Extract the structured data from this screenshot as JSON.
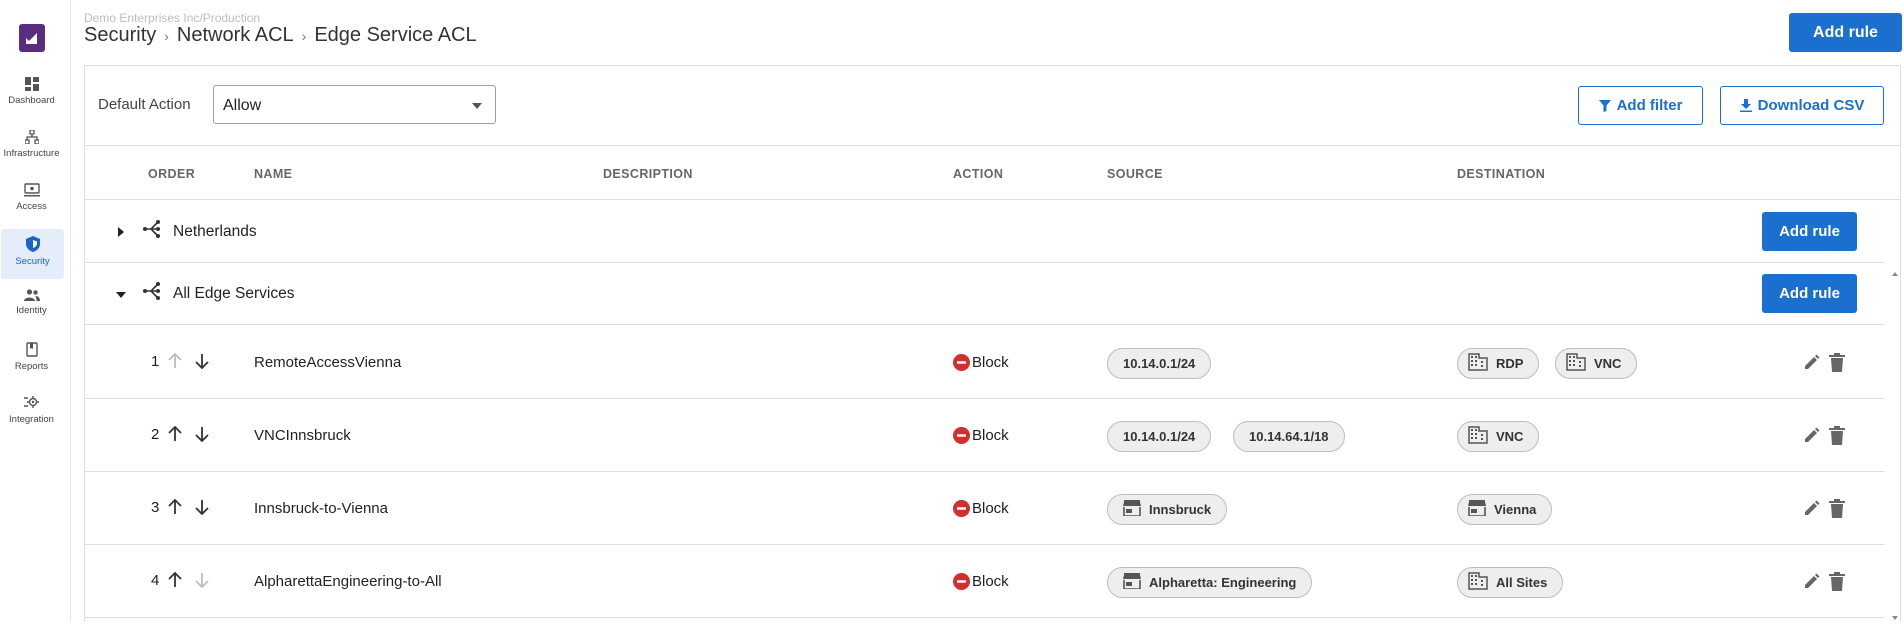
{
  "sidebar": {
    "items": [
      {
        "label": "Dashboard",
        "icon": "dashboard-icon"
      },
      {
        "label": "Infrastructure",
        "icon": "infrastructure-icon"
      },
      {
        "label": "Access",
        "icon": "access-icon"
      },
      {
        "label": "Security",
        "icon": "shield-icon",
        "active": true
      },
      {
        "label": "Identity",
        "icon": "people-icon"
      },
      {
        "label": "Reports",
        "icon": "reports-icon"
      },
      {
        "label": "Integration",
        "icon": "integration-icon"
      }
    ]
  },
  "header": {
    "org": "Demo Enterprises Inc/Production",
    "breadcrumb": [
      "Security",
      "Network ACL",
      "Edge Service ACL"
    ],
    "add_rule": "Add rule"
  },
  "toolbar": {
    "default_action_label": "Default Action",
    "default_action_value": "Allow",
    "add_filter": "Add filter",
    "download_csv": "Download CSV"
  },
  "table": {
    "columns": [
      "ORDER",
      "NAME",
      "DESCRIPTION",
      "ACTION",
      "SOURCE",
      "DESTINATION"
    ],
    "groups": [
      {
        "name": "Netherlands",
        "expanded": false,
        "add_rule": "Add rule"
      },
      {
        "name": "All Edge Services",
        "expanded": true,
        "add_rule": "Add rule"
      }
    ],
    "rows": [
      {
        "order": "1",
        "name": "RemoteAccessVienna",
        "action": "Block",
        "source": [
          {
            "label": "10.14.0.1/24",
            "icon": ""
          }
        ],
        "destination": [
          {
            "label": "RDP",
            "icon": "building-icon"
          },
          {
            "label": "VNC",
            "icon": "building-icon"
          }
        ]
      },
      {
        "order": "2",
        "name": "VNCInnsbruck",
        "action": "Block",
        "source": [
          {
            "label": "10.14.0.1/24",
            "icon": ""
          },
          {
            "label": "10.14.64.1/18",
            "icon": ""
          }
        ],
        "destination": [
          {
            "label": "VNC",
            "icon": "building-icon"
          }
        ]
      },
      {
        "order": "3",
        "name": "Innsbruck-to-Vienna",
        "action": "Block",
        "source": [
          {
            "label": "Innsbruck",
            "icon": "store-icon"
          }
        ],
        "destination": [
          {
            "label": "Vienna",
            "icon": "store-icon"
          }
        ]
      },
      {
        "order": "4",
        "name": "AlpharettaEngineering-to-All",
        "action": "Block",
        "source": [
          {
            "label": "Alpharetta: Engineering",
            "icon": "store-icon"
          }
        ],
        "destination": [
          {
            "label": "All Sites",
            "icon": "building-icon"
          }
        ]
      }
    ]
  },
  "colors": {
    "primary": "#1a6fcf",
    "block": "#d32f2f",
    "logo": "#5b2d7f"
  }
}
